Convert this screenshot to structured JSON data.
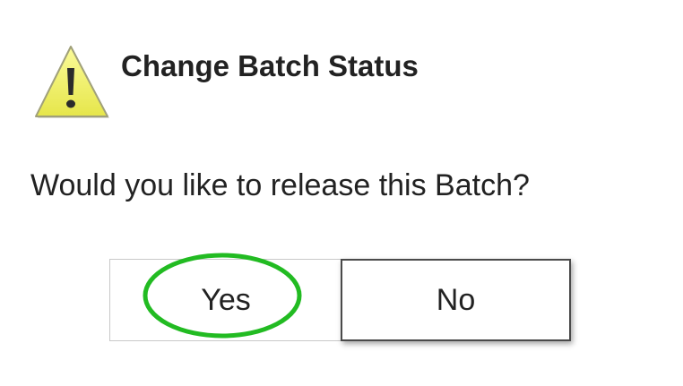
{
  "dialog": {
    "title": "Change Batch Status",
    "icon": "warning-icon",
    "message": "Would you like to release this Batch?"
  },
  "buttons": {
    "yes_label": "Yes",
    "no_label": "No"
  },
  "annotation": {
    "target": "yes-button",
    "color": "#22bb22"
  },
  "colors": {
    "warning_fill": "#f0f06a",
    "warning_outline": "#9a9a7a",
    "text": "#222222"
  }
}
